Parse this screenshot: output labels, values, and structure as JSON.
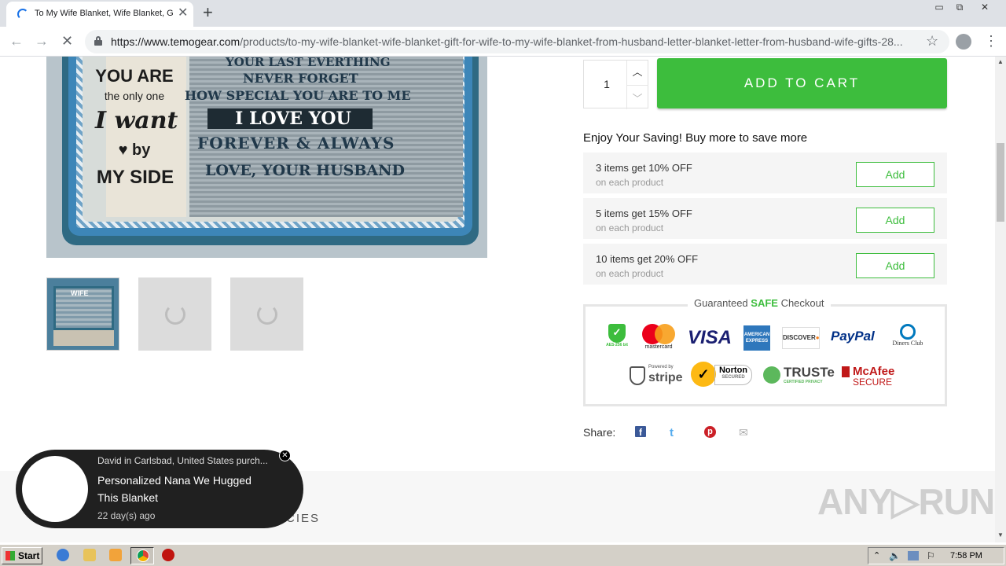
{
  "browser": {
    "tab_title": "To My Wife Blanket, Wife Blanket, G",
    "tab_close": "✕",
    "new_tab": "+",
    "url_host": "https://www.temogear.com",
    "url_path": "/products/to-my-wife-blanket-wife-blanket-gift-for-wife-to-my-wife-blanket-from-husband-letter-blanket-letter-from-husband-wife-gifts-28...",
    "window_controls": {
      "minimize": "▭",
      "restore": "⧉",
      "close": "✕"
    },
    "nav": {
      "back": "←",
      "forward": "→",
      "stop": "✕",
      "star": "☆",
      "menu": "⋮"
    }
  },
  "product_image": {
    "line1": "YOUR LAST EVERTHING",
    "line2": "NEVER FORGET",
    "line3": "HOW SPECIAL YOU ARE TO ME",
    "line4": "I LOVE YOU",
    "line5": "FOREVER & ALWAYS",
    "line6": "LOVE, YOUR HUSBAND",
    "left1": "YOU ARE",
    "left2": "the only one",
    "left3": "I want",
    "left4": "♥ by",
    "left5": "MY SIDE",
    "thumb_label": "WIFE"
  },
  "purchase": {
    "quantity": "1",
    "qty_up": "︿",
    "qty_down": "﹀",
    "add_to_cart": "ADD TO CART"
  },
  "saving": {
    "title": "Enjoy Your Saving! Buy more to save more",
    "tiers": [
      {
        "title": "3 items get 10% OFF",
        "sub": "on each product",
        "button": "Add"
      },
      {
        "title": "5 items get 15% OFF",
        "sub": "on each product",
        "button": "Add"
      },
      {
        "title": "10 items get 20% OFF",
        "sub": "on each product",
        "button": "Add"
      }
    ]
  },
  "safe_checkout": {
    "title_prefix": "Guaranteed ",
    "title_highlight": "SAFE",
    "title_suffix": " Checkout",
    "logos": {
      "aes": "AES-256 bit",
      "mastercard": "mastercard",
      "visa": "VISA",
      "amex": "AMERICAN EXPRESS",
      "discover": "DISCOVER",
      "paypal": "PayPal",
      "diners": "Diners Club",
      "stripe": "stripe",
      "stripe_small": "Powered by",
      "norton": "Norton",
      "norton_small": "SECURED",
      "truste": "TRUSTe",
      "truste_small": "CERTIFIED PRIVACY",
      "mcafee": "McAfee",
      "mcafee_small": "SECURE"
    }
  },
  "share": {
    "label": "Share:",
    "facebook": "f",
    "twitter": "t",
    "pinterest": "p",
    "email": "✉"
  },
  "footer": {
    "text": "CIES",
    "watermark": "ANY▷RUN"
  },
  "popup": {
    "line1": "David in Carlsbad, United States purch...",
    "product": "Personalized Nana We Hugged This Blanket",
    "time": "22 day(s) ago",
    "close": "✕"
  },
  "taskbar": {
    "start": "Start",
    "time": "7:58 PM"
  },
  "colors": {
    "accent_green": "#3dbd3d",
    "chrome_blue": "#1a73e8"
  }
}
